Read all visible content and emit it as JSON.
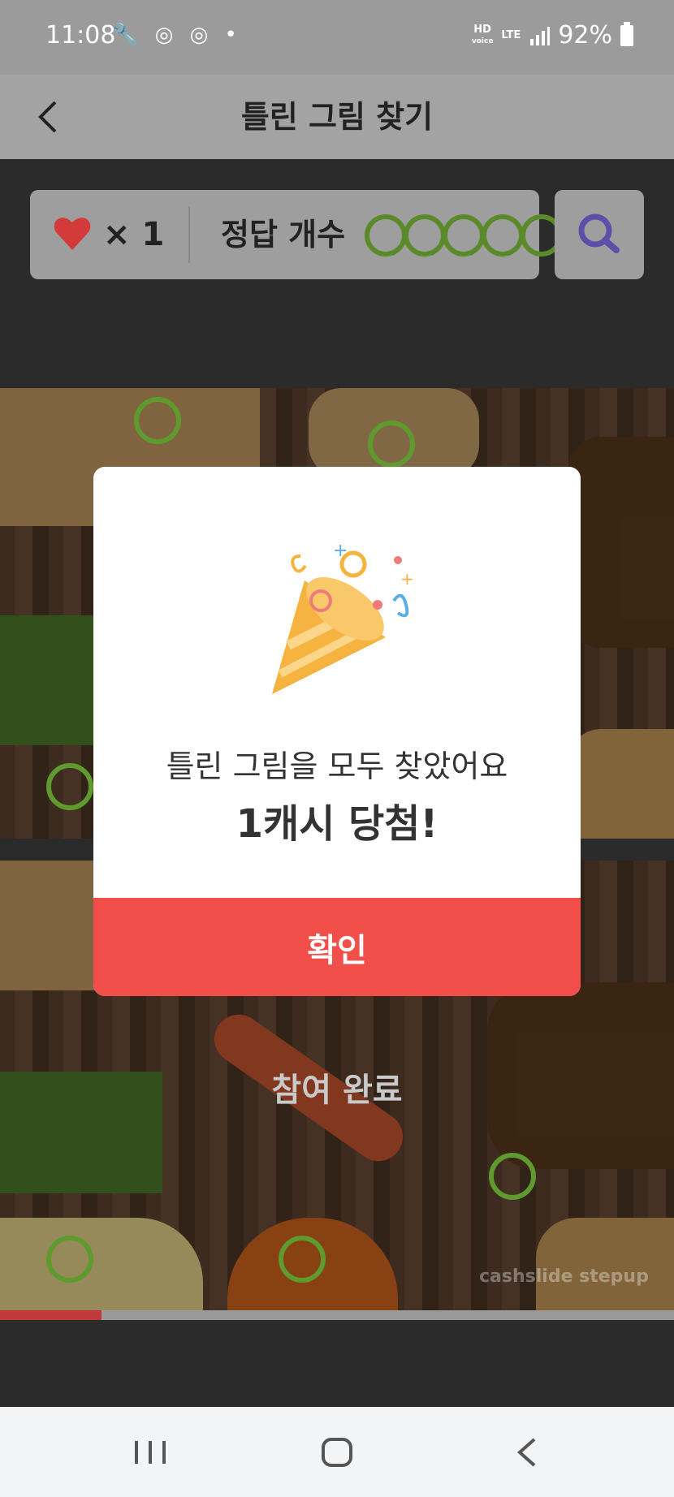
{
  "status_bar": {
    "time": "11:08",
    "left_icons": "🔧 ◎ ◎ •",
    "hd": "HD",
    "voice": "voice",
    "lte": "LTE",
    "battery": "92%"
  },
  "header": {
    "title": "틀린 그림 찾기"
  },
  "info": {
    "lives": "× 1",
    "answer_label": "정답 개수",
    "found_count": 5,
    "total_count": 5
  },
  "game": {
    "completed_label": "참여 완료",
    "watermark": "cashslide stepup",
    "progress_fraction": 0.15
  },
  "modal": {
    "message": "틀린 그림을 모두 찾았어요",
    "prize": "1캐시 당첨!",
    "confirm_label": "확인"
  },
  "colors": {
    "accent": "#f24f4b",
    "found_ring": "#5a8a2a",
    "heart": "#d33a3a"
  }
}
